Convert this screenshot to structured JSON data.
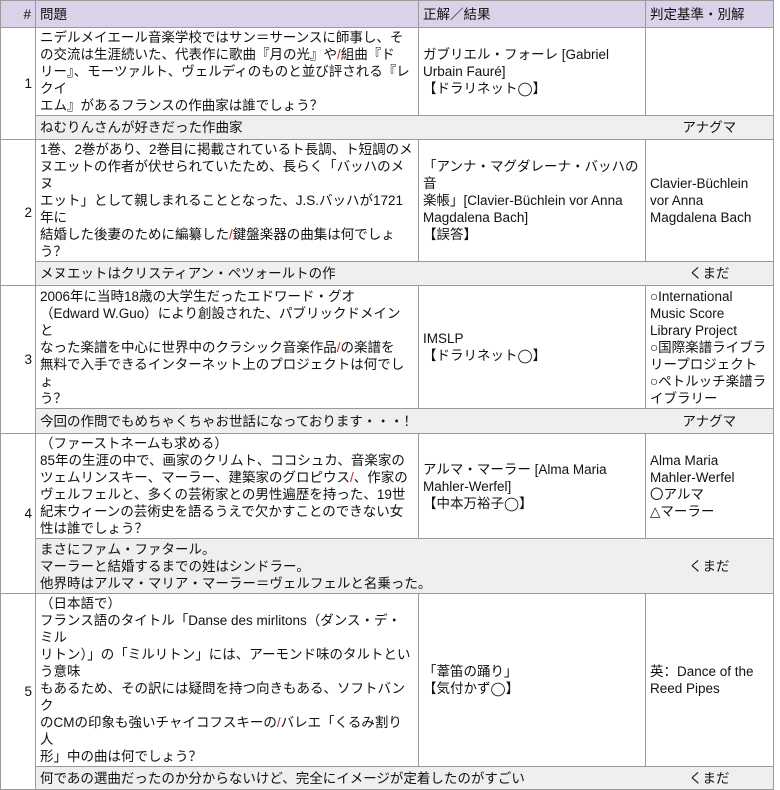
{
  "header": {
    "num": "#",
    "question": "問題",
    "answer": "正解／結果",
    "criteria": "判定基準・別解"
  },
  "rows": [
    {
      "num": "1",
      "question": [
        "ニデルメイエール音楽学校ではサン＝サーンスに師事し、そ",
        "の交流は生涯続いた、代表作に歌曲『月の光』や/組曲『ド",
        "リー』、モーツァルト、ヴェルディのものと並び評される『レクイ",
        "エム』があるフランスの作曲家は誰でしょう？"
      ],
      "answer": [
        "ガブリエル・フォーレ [Gabriel",
        "Urbain Fauré]",
        "【ドラリネット◯】"
      ],
      "criteria": [],
      "comment": [
        "ねむりんさんが好きだった作曲家"
      ],
      "author": "アナグマ"
    },
    {
      "num": "2",
      "question": [
        "1巻、2巻があり、2巻目に掲載されているト長調、ト短調のメ",
        "ヌエットの作者が伏せられていたため、長らく「バッハのメヌ",
        "エット」として親しまれることとなった、J.S.バッハが1721年に",
        "結婚した後妻のために編纂した/鍵盤楽器の曲集は何でしょ",
        "う？"
      ],
      "answer": [
        "「アンナ・マグダレーナ・バッハの音",
        "楽帳」[Clavier-Büchlein vor Anna",
        "Magdalena Bach]",
        "【誤答】"
      ],
      "criteria": [
        "Clavier-Büchlein",
        "vor Anna",
        "Magdalena Bach"
      ],
      "comment": [
        "メヌエットはクリスティアン・ペツォールトの作"
      ],
      "author": "くまだ"
    },
    {
      "num": "3",
      "question": [
        "2006年に当時18歳の大学生だったエドワード・グオ",
        "（Edward W.Guo）により創設された、パブリックドメインと",
        "なった楽譜を中心に世界中のクラシック音楽作品/の楽譜を",
        "無料で入手できるインターネット上のプロジェクトは何でしょ",
        "う？"
      ],
      "answer": [
        "IMSLP",
        "【ドラリネット◯】"
      ],
      "criteria": [
        "○International",
        "Music Score",
        "Library Project",
        "○国際楽譜ライブラ",
        "リープロジェクト",
        "○ペトルッチ楽譜ラ",
        "イブラリー"
      ],
      "comment": [
        "今回の作問でもめちゃくちゃお世話になっております・・・！"
      ],
      "author": "アナグマ"
    },
    {
      "num": "4",
      "question": [
        "（ファーストネームも求める）",
        "85年の生涯の中で、画家のクリムト、ココシュカ、音楽家の",
        "ツェムリンスキー、マーラー、建築家のグロピウス/、作家の",
        "ヴェルフェルと、多くの芸術家との男性遍歴を持った、19世",
        "紀末ウィーンの芸術史を語るうえで欠かすことのできない女",
        "性は誰でしょう？"
      ],
      "answer": [
        "アルマ・マーラー [Alma Maria",
        "Mahler-Werfel]",
        "【中本万裕子◯】"
      ],
      "criteria": [
        "Alma Maria",
        "Mahler-Werfel",
        "〇アルマ",
        "△マーラー"
      ],
      "comment": [
        "まさにファム・ファタール。",
        "マーラーと結婚するまでの姓はシンドラー。",
        "他界時はアルマ・マリア・マーラー＝ヴェルフェルと名乗った。"
      ],
      "author": "くまだ"
    },
    {
      "num": "5",
      "question": [
        "（日本語で）",
        "フランス語のタイトル「Danse des mirlitons（ダンス・デ・ミル",
        "リトン）」の「ミルリトン」には、アーモンド味のタルトという意味",
        "もあるため、その訳には疑問を持つ向きもある、ソフトバンク",
        "のCMの印象も強いチャイコフスキーの/バレエ「くるみ割り人",
        "形」中の曲は何でしょう？"
      ],
      "answer": [
        "「葦笛の踊り」",
        "【気付かず◯】"
      ],
      "criteria": [
        "英：Dance of the",
        "Reed Pipes"
      ],
      "comment": [
        "何であの選曲だったのか分からないけど、完全にイメージが定着したのがすごい"
      ],
      "author": "くまだ"
    }
  ],
  "colors": {
    "header_bg": "#d9d2e9",
    "comment_bg": "#efefef",
    "slash": "#e02020"
  }
}
